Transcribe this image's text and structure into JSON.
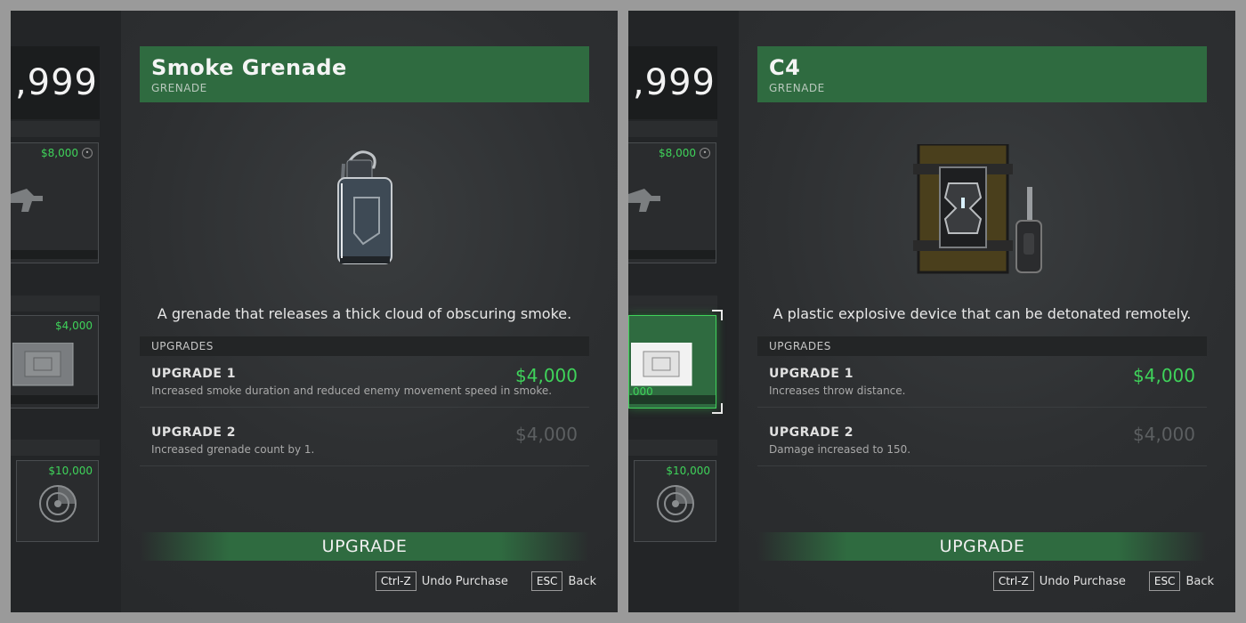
{
  "panels": [
    {
      "money": ",999",
      "cards": [
        {
          "price": "$8,000",
          "locked": true
        },
        {
          "price": "$4,000",
          "locked": false
        },
        {
          "price": "$10,000",
          "locked": false
        }
      ],
      "item": {
        "name": "Smoke Grenade",
        "type": "GRENADE",
        "icon": "smoke-grenade-icon",
        "description": "A grenade that releases a thick cloud of obscuring smoke."
      },
      "upgrades_header": "UPGRADES",
      "upgrades": [
        {
          "title": "UPGRADE 1",
          "desc": "Increased smoke duration and reduced enemy movement speed in smoke.",
          "price": "$4,000",
          "available": true
        },
        {
          "title": "UPGRADE 2",
          "desc": "Increased grenade count by 1.",
          "price": "$4,000",
          "available": false
        }
      ],
      "upgrade_button": "UPGRADE",
      "hints": [
        {
          "key": "Ctrl-Z",
          "label": "Undo Purchase"
        },
        {
          "key": "ESC",
          "label": "Back"
        }
      ]
    },
    {
      "money": ",999",
      "cards": [
        {
          "price": "$8,000",
          "locked": true
        },
        {
          "price": ",000",
          "locked": false
        },
        {
          "price": "$10,000",
          "locked": false
        }
      ],
      "item": {
        "name": "C4",
        "type": "GRENADE",
        "icon": "c4-explosive-icon",
        "description": "A plastic explosive device that can be detonated remotely."
      },
      "upgrades_header": "UPGRADES",
      "upgrades": [
        {
          "title": "UPGRADE 1",
          "desc": "Increases throw distance.",
          "price": "$4,000",
          "available": true
        },
        {
          "title": "UPGRADE 2",
          "desc": "Damage increased to 150.",
          "price": "$4,000",
          "available": false
        }
      ],
      "upgrade_button": "UPGRADE",
      "hints": [
        {
          "key": "Ctrl-Z",
          "label": "Undo Purchase"
        },
        {
          "key": "ESC",
          "label": "Back"
        }
      ]
    }
  ],
  "colors": {
    "accent_green": "#2f6b40",
    "price_green": "#3fd35a",
    "price_dim": "#5c5f61"
  }
}
